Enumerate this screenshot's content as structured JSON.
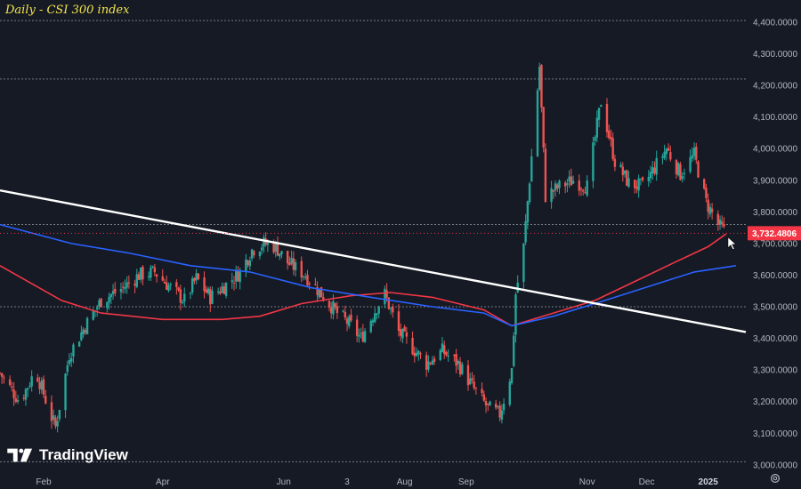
{
  "title": "Daily - CSI 300 index",
  "brand": "TradingView",
  "colors": {
    "background": "#161a25",
    "up": "#26a69a",
    "down": "#ef5350",
    "ma_red": "#f23645",
    "ma_blue": "#2962ff",
    "trendline": "#ffffff",
    "hline": "#787b86"
  },
  "icons": [
    "tradingview-logo-icon",
    "settings-gear-icon",
    "mouse-cursor-icon"
  ],
  "chart_data": {
    "type": "candlestick",
    "y_axis_position": "right",
    "ylim": [
      2980,
      4470
    ],
    "yticks": [
      "3,000.0000",
      "3,100.0000",
      "3,200.0000",
      "3,300.0000",
      "3,400.0000",
      "3,500.0000",
      "3,600.0000",
      "3,700.0000",
      "3,800.0000",
      "3,900.0000",
      "4,000.0000",
      "4,100.0000",
      "4,200.0000",
      "4,300.0000",
      "4,400.0000"
    ],
    "ytick_values": [
      3000,
      3100,
      3200,
      3300,
      3400,
      3500,
      3600,
      3700,
      3800,
      3900,
      4000,
      4100,
      4200,
      4300,
      4400
    ],
    "xticks": [
      {
        "label": "Feb",
        "date": "2024-02-01",
        "bold": false
      },
      {
        "label": "Apr",
        "date": "2024-04-01",
        "bold": false
      },
      {
        "label": "Jun",
        "date": "2024-06-01",
        "bold": false
      },
      {
        "label": "3",
        "date": "2024-07-03",
        "bold": false
      },
      {
        "label": "Aug",
        "date": "2024-08-01",
        "bold": false
      },
      {
        "label": "Sep",
        "date": "2024-09-01",
        "bold": false
      },
      {
        "label": "Nov",
        "date": "2024-11-01",
        "bold": false
      },
      {
        "label": "Dec",
        "date": "2024-12-01",
        "bold": false
      },
      {
        "label": "2025",
        "date": "2025-01-01",
        "bold": true
      }
    ],
    "last_price": "3,732.4806",
    "last_price_value": 3732.4806,
    "horizontal_lines": [
      3500,
      3760,
      4220,
      4405,
      3010
    ],
    "trendline": {
      "start": {
        "date": "2024-01-10",
        "value": 3868
      },
      "end": {
        "date": "2025-01-20",
        "value": 3420
      }
    },
    "series": [
      {
        "kind": "close",
        "points": [
          [
            "2024-01-10",
            3290
          ],
          [
            "2024-01-20",
            3200
          ],
          [
            "2024-01-28",
            3300
          ],
          [
            "2024-02-05",
            3150
          ],
          [
            "2024-02-07",
            3120
          ],
          [
            "2024-02-14",
            3350
          ],
          [
            "2024-02-22",
            3440
          ],
          [
            "2024-03-01",
            3520
          ],
          [
            "2024-03-12",
            3560
          ],
          [
            "2024-03-20",
            3600
          ],
          [
            "2024-03-28",
            3610
          ],
          [
            "2024-04-05",
            3560
          ],
          [
            "2024-04-12",
            3520
          ],
          [
            "2024-04-18",
            3590
          ],
          [
            "2024-04-25",
            3530
          ],
          [
            "2024-05-03",
            3570
          ],
          [
            "2024-05-10",
            3610
          ],
          [
            "2024-05-16",
            3680
          ],
          [
            "2024-05-22",
            3700
          ],
          [
            "2024-05-28",
            3690
          ],
          [
            "2024-06-03",
            3640
          ],
          [
            "2024-06-12",
            3600
          ],
          [
            "2024-06-20",
            3540
          ],
          [
            "2024-06-28",
            3480
          ],
          [
            "2024-07-05",
            3440
          ],
          [
            "2024-07-10",
            3400
          ],
          [
            "2024-07-18",
            3500
          ],
          [
            "2024-07-22",
            3540
          ],
          [
            "2024-07-29",
            3420
          ],
          [
            "2024-08-05",
            3370
          ],
          [
            "2024-08-12",
            3320
          ],
          [
            "2024-08-20",
            3360
          ],
          [
            "2024-08-28",
            3320
          ],
          [
            "2024-09-05",
            3240
          ],
          [
            "2024-09-12",
            3180
          ],
          [
            "2024-09-18",
            3160
          ],
          [
            "2024-09-24",
            3300
          ],
          [
            "2024-09-26",
            3540
          ],
          [
            "2024-09-30",
            3690
          ],
          [
            "2024-10-08",
            4260
          ],
          [
            "2024-10-11",
            3850
          ],
          [
            "2024-10-18",
            3880
          ],
          [
            "2024-10-25",
            3900
          ],
          [
            "2024-11-01",
            3880
          ],
          [
            "2024-11-08",
            4150
          ],
          [
            "2024-11-15",
            3960
          ],
          [
            "2024-11-22",
            3890
          ],
          [
            "2024-11-29",
            3880
          ],
          [
            "2024-12-06",
            3950
          ],
          [
            "2024-12-11",
            4000
          ],
          [
            "2024-12-18",
            3920
          ],
          [
            "2024-12-25",
            3980
          ],
          [
            "2024-12-31",
            3830
          ],
          [
            "2025-01-06",
            3760
          ],
          [
            "2025-01-10",
            3732
          ]
        ]
      },
      {
        "name": "MA (red)",
        "kind": "line",
        "points": [
          [
            "2024-01-10",
            3630
          ],
          [
            "2024-02-10",
            3520
          ],
          [
            "2024-03-01",
            3480
          ],
          [
            "2024-04-01",
            3460
          ],
          [
            "2024-05-01",
            3460
          ],
          [
            "2024-05-20",
            3470
          ],
          [
            "2024-06-10",
            3510
          ],
          [
            "2024-07-05",
            3535
          ],
          [
            "2024-07-25",
            3545
          ],
          [
            "2024-08-15",
            3530
          ],
          [
            "2024-09-10",
            3490
          ],
          [
            "2024-09-24",
            3440
          ],
          [
            "2024-10-15",
            3480
          ],
          [
            "2024-11-05",
            3520
          ],
          [
            "2024-11-25",
            3580
          ],
          [
            "2024-12-15",
            3640
          ],
          [
            "2025-01-01",
            3690
          ],
          [
            "2025-01-10",
            3730
          ]
        ]
      },
      {
        "name": "MA (blue)",
        "kind": "line",
        "points": [
          [
            "2024-01-10",
            3760
          ],
          [
            "2024-02-15",
            3700
          ],
          [
            "2024-03-15",
            3670
          ],
          [
            "2024-04-15",
            3630
          ],
          [
            "2024-05-15",
            3610
          ],
          [
            "2024-06-15",
            3560
          ],
          [
            "2024-07-15",
            3530
          ],
          [
            "2024-08-15",
            3500
          ],
          [
            "2024-09-10",
            3480
          ],
          [
            "2024-09-24",
            3440
          ],
          [
            "2024-10-15",
            3470
          ],
          [
            "2024-11-10",
            3520
          ],
          [
            "2024-12-05",
            3570
          ],
          [
            "2024-12-25",
            3610
          ],
          [
            "2025-01-15",
            3630
          ]
        ]
      }
    ]
  }
}
